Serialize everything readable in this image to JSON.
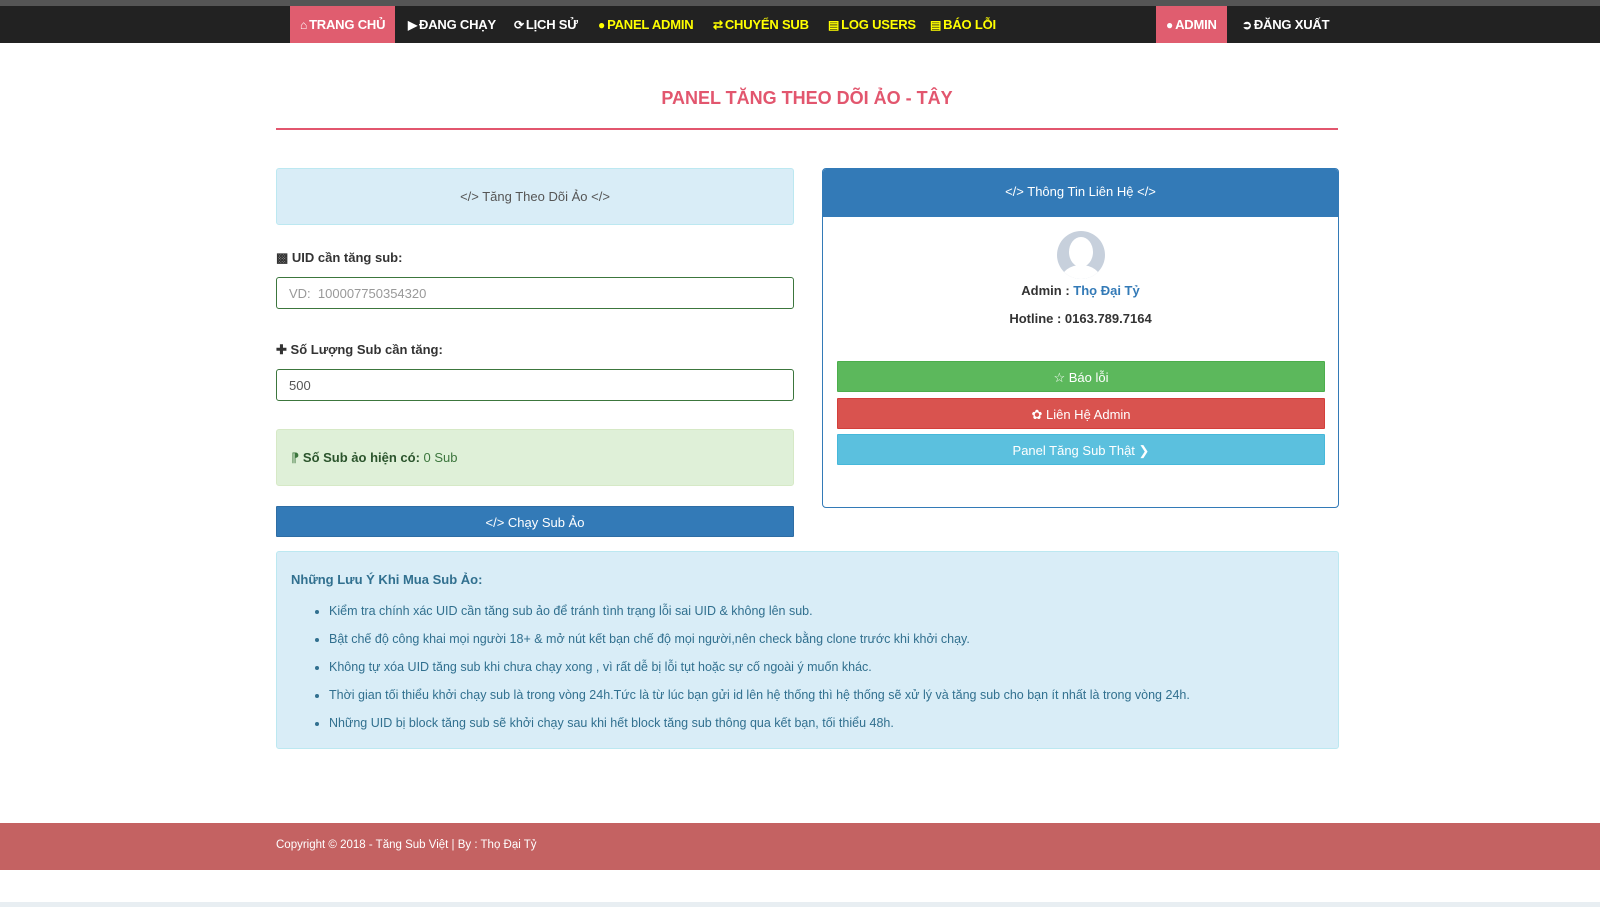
{
  "nav": {
    "home": "TRANG CHỦ",
    "running": "ĐANG CHẠY",
    "history": "LỊCH SỬ",
    "panel_admin": "PANEL ADMIN",
    "transfer_sub": "CHUYỂN SUB",
    "log_users": "LOG USERS",
    "report_error": "BÁO LỖI",
    "admin": "ADMIN",
    "logout": "ĐĂNG XUẤT"
  },
  "page": {
    "title": "PANEL TĂNG THEO DÕI ẢO - TÂY"
  },
  "form": {
    "panel_heading": "</> Tăng Theo Dõi Ảo </>",
    "uid_label": "UID cần tăng sub:",
    "uid_placeholder": "VD:  100007750354320",
    "quantity_label": "Số Lượng Sub cần tăng:",
    "quantity_value": "500",
    "current_label": "Số Sub ảo hiện có:",
    "current_value": "0 Sub",
    "run_button": "</> Chạy Sub Ảo"
  },
  "contact": {
    "heading": "</> Thông Tin Liên Hệ </>",
    "admin_prefix": "Admin : ",
    "admin_name": "Thọ Đại Tỷ",
    "hotline": "Hotline : 0163.789.7164",
    "report_button": "Báo lỗi",
    "contact_button": "Liên Hệ Admin",
    "real_sub_button": "Panel Tăng Sub Thật"
  },
  "notes": {
    "title": "Những Lưu Ý Khi Mua Sub Ảo:",
    "items": [
      "Kiểm tra chính xác UID cần tăng sub ảo để tránh tình trạng lỗi sai UID & không lên sub.",
      "Bật chế độ công khai mọi người 18+ & mở nút kết bạn chế độ mọi người,nên check bằng clone trước khi khởi chạy.",
      "Không tự xóa UID tăng sub khi chưa chạy xong , vì rất dễ bị lỗi tụt hoặc sự cố ngoài ý muốn khác.",
      "Thời gian tối thiểu khởi chạy sub là trong vòng 24h.Tức là từ lúc bạn gửi id lên hệ thống thì hệ thống sẽ xử lý và tăng sub cho bạn ít nhất là trong vòng 24h.",
      "Những UID bị block tăng sub sẽ khởi chạy sau khi hết block tăng sub thông qua kết bạn, tối thiểu 48h."
    ]
  },
  "footer": {
    "copyright": "Copyright © 2018 - Tăng Sub Việt | By : Thọ Đại Tỷ"
  },
  "colors": {
    "accent": "#e2566e",
    "nav_bg": "#222222",
    "nav_yellow": "#ffff00",
    "primary": "#337ab7",
    "success": "#5cb85c",
    "danger": "#d9534f",
    "info": "#5bc0de",
    "footer": "#c46262"
  },
  "icons": {
    "home": "home-icon",
    "running": "play-icon",
    "history": "refresh-icon",
    "panel_admin": "user-icon",
    "transfer_sub": "shuffle-icon",
    "log_users": "list-icon",
    "report_error": "list-icon",
    "admin": "user-icon",
    "logout": "logout-icon",
    "uid": "id-card-icon",
    "quantity": "plus-icon",
    "current": "rss-icon",
    "report": "star-icon",
    "contact": "paw-icon",
    "real_sub": "chevron-right-icon"
  }
}
